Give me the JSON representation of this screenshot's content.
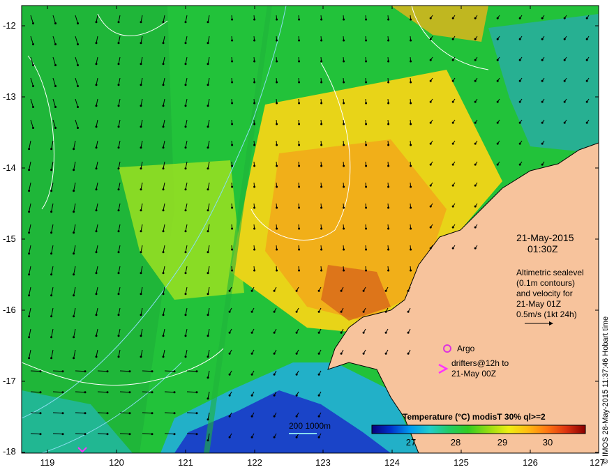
{
  "map": {
    "y_ticks": [
      "-12",
      "-13",
      "-14",
      "-15",
      "-16",
      "-17",
      "-18"
    ],
    "x_ticks": [
      "119",
      "120",
      "121",
      "122",
      "123",
      "124",
      "125",
      "126",
      "127"
    ],
    "date": "21-May-2015",
    "time": "01:30Z",
    "altimetry_note": [
      "Altimetric sealevel",
      "(0.1m contours)",
      "and velocity for",
      "21-May 01Z",
      "0.5m/s (1kt 24h)"
    ],
    "argo_label": "Argo",
    "drifters_label": [
      "drifters@12h to",
      "21-May 00Z"
    ],
    "depth_label": "200  1000m",
    "credit": "© IMOS 28-May-2015 11:37:46 Hobart time",
    "colorbar": {
      "title": "Temperature (°C) modisT 30% ql>=2",
      "ticks": [
        "27",
        "28",
        "29",
        "30"
      ],
      "colors": [
        "#08007a",
        "#0033cc",
        "#0099ee",
        "#22cccc",
        "#22cc66",
        "#33cc22",
        "#99dd11",
        "#eeee11",
        "#ffbb11",
        "#ff7711",
        "#dd3311",
        "#880000"
      ]
    },
    "colors": {
      "land": "#f7c39c",
      "argo": "#dd33dd",
      "drifter": "#ff33ff",
      "contour": "#ffffff",
      "isobath": "#88ddee"
    },
    "icons": [
      "argo-float-icon",
      "drifter-arrow-icon",
      "velocity-scale-arrow-icon"
    ]
  }
}
